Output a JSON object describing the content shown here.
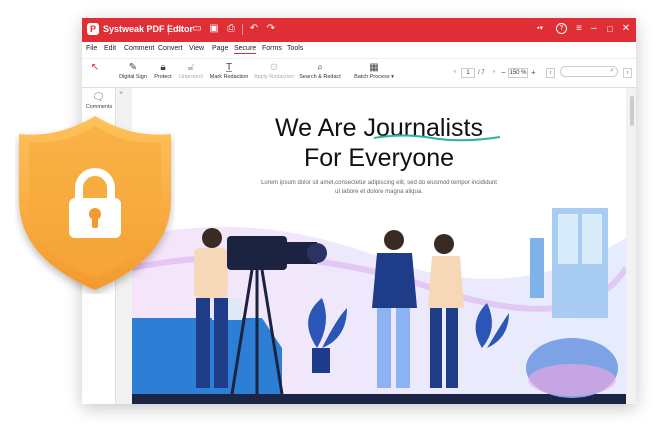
{
  "app": {
    "title": "Systweak PDF Editor"
  },
  "menu": [
    "File",
    "Edit",
    "Comment",
    "Convert",
    "View",
    "Page",
    "Secure",
    "Forms",
    "Tools"
  ],
  "menu_active": "Secure",
  "toolbar": {
    "digital_sign": "Digital Sign",
    "protect": "Protect",
    "unprotect": "Unprotect",
    "mark_redaction": "Mark Redaction",
    "apply_redaction": "Apply Redaction",
    "search_redact": "Search & Redact",
    "batch_process": "Batch Process"
  },
  "pager": {
    "current": "1",
    "total": "/ 7",
    "zoom": "150 %"
  },
  "sidebar": {
    "comments": "Comments"
  },
  "document": {
    "headline_line1": "We Are Journalists",
    "headline_line2": "For Everyone",
    "lorem_line1": "Lorem ipsum dolor sit amet,consectetur adipiscing elit, sed do eiusmod tempor incididunt",
    "lorem_line2": "ut labore et dolore magna aliqua."
  },
  "colors": {
    "brand": "#e02e35",
    "shield": "#f6a33a"
  },
  "icons": {
    "lock": "lock-icon",
    "shield": "shield-icon"
  }
}
